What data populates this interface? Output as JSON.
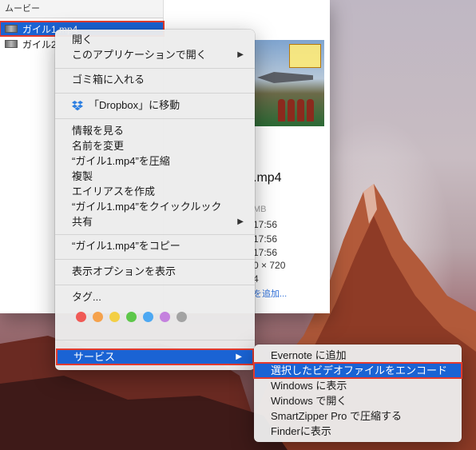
{
  "finder": {
    "column_header": "ムービー",
    "files": [
      {
        "name": "ガイル1.mp4",
        "selected": true
      },
      {
        "name": "ガイル2"
      }
    ],
    "preview": {
      "filename": ".mp4",
      "size": "MB",
      "created": "17:56",
      "modified": "17:56",
      "opened": "17:56",
      "dimensions": "0 × 720",
      "codec": "4",
      "add_tags": "を追加..."
    }
  },
  "context_menu": {
    "open": "開く",
    "open_with": "このアプリケーションで開く",
    "move_to_trash": "ゴミ箱に入れる",
    "dropbox_move": "「Dropbox」に移動",
    "get_info": "情報を見る",
    "rename": "名前を変更",
    "compress": "“ガイル1.mp4”を圧縮",
    "duplicate": "複製",
    "make_alias": "エイリアスを作成",
    "quick_look": "“ガイル1.mp4”をクイックルック",
    "share": "共有",
    "copy": "“ガイル1.mp4”をコピー",
    "show_view_options": "表示オプションを表示",
    "tags": "タグ...",
    "tag_colors": [
      "#f05a56",
      "#f5a24c",
      "#f3cf45",
      "#5ec74a",
      "#4da8f2",
      "#c481de",
      "#a3a3a3"
    ],
    "services": "サービス"
  },
  "services_submenu": {
    "items": [
      "Evernote に追加",
      "選択したビデオファイルをエンコード",
      "Windows に表示",
      "Windows で開く",
      "SmartZipper Pro で圧縮する",
      "Finderに表示"
    ],
    "highlighted_index": 1
  },
  "colors": {
    "highlight": "#1a63d4",
    "annotation_outline": "#e23a2e"
  }
}
